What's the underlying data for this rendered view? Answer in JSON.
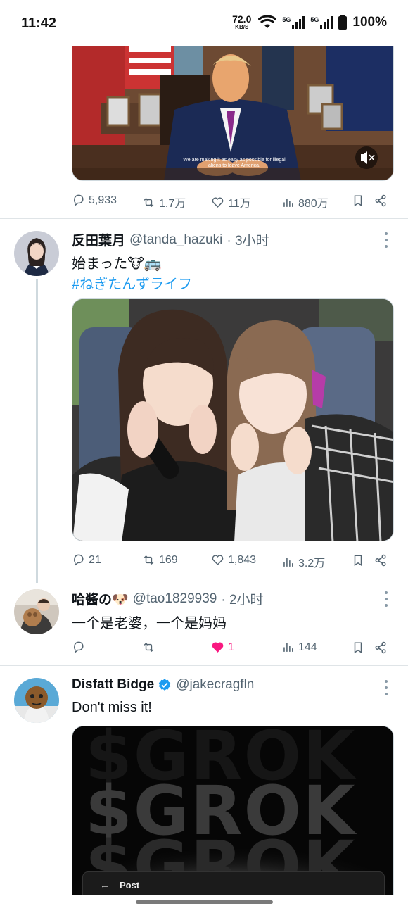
{
  "status_bar": {
    "time": "11:42",
    "net_speed": "72.0",
    "net_unit": "KB/S",
    "network_1": "5G",
    "network_2": "5G",
    "battery": "100%"
  },
  "tweet1": {
    "video_caption": "We are making it as easy as possible for illegal aliens to leave America.",
    "stats": {
      "replies": "5,933",
      "retweets": "1.7万",
      "likes": "11万",
      "views": "880万"
    }
  },
  "tweet2": {
    "name": "反田葉月",
    "handle": "@tanda_hazuki",
    "time": "· 3小时",
    "text": "始まった🐮🚌",
    "hashtag": "#ねぎたんずライフ",
    "stats": {
      "replies": "21",
      "retweets": "169",
      "likes": "1,843",
      "views": "3.2万"
    }
  },
  "tweet3": {
    "name": "哈酱の🐶",
    "handle": "@tao1829939",
    "time": "· 2小时",
    "text": "一个是老婆，一个是妈妈",
    "stats": {
      "likes": "1",
      "views": "144"
    }
  },
  "tweet4": {
    "name": "Disfatt Bidge",
    "handle": "@jakecragfln",
    "text": "Don't miss it!",
    "banner_words": [
      "$GROK",
      "$GROK",
      "$GROK"
    ],
    "post_label": "Post"
  },
  "colors": {
    "accent": "#1d9bf0",
    "like_active": "#f91880",
    "muted": "#536471"
  }
}
